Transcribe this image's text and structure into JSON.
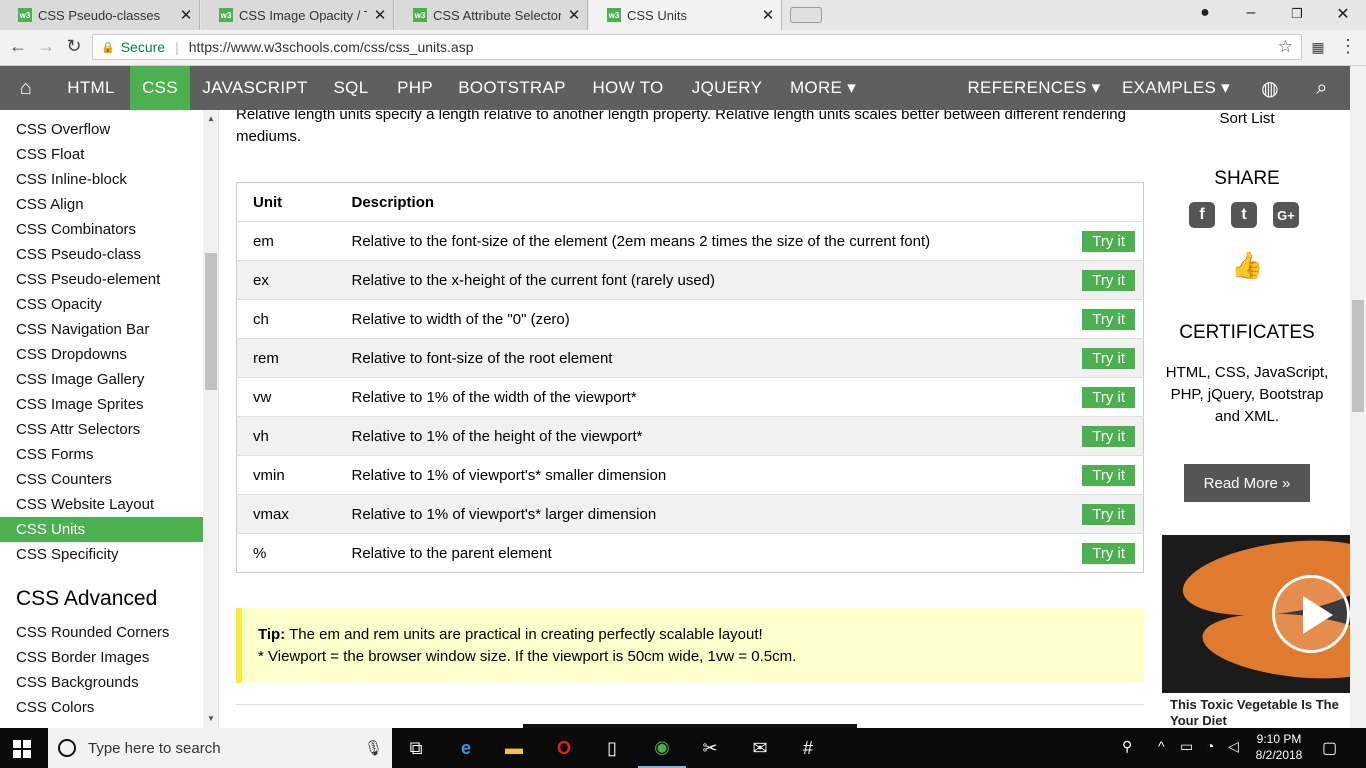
{
  "browser": {
    "tabs": [
      {
        "title": "CSS Pseudo-classes",
        "favicon": "w3"
      },
      {
        "title": "CSS Image Opacity / Tran",
        "favicon": "w3"
      },
      {
        "title": "CSS Attribute Selector",
        "favicon": "w3"
      },
      {
        "title": "CSS Units",
        "favicon": "w3",
        "active": true
      }
    ],
    "secure_label": "Secure",
    "url": "https://www.w3schools.com/css/css_units.asp"
  },
  "topnav": {
    "items": [
      "HTML",
      "CSS",
      "JAVASCRIPT",
      "SQL",
      "PHP",
      "BOOTSTRAP",
      "HOW TO",
      "JQUERY",
      "MORE ▾",
      "REFERENCES ▾",
      "EXAMPLES ▾"
    ],
    "active": "CSS"
  },
  "sidebar": {
    "items": [
      "CSS Overflow",
      "CSS Float",
      "CSS Inline-block",
      "CSS Align",
      "CSS Combinators",
      "CSS Pseudo-class",
      "CSS Pseudo-element",
      "CSS Opacity",
      "CSS Navigation Bar",
      "CSS Dropdowns",
      "CSS Image Gallery",
      "CSS Image Sprites",
      "CSS Attr Selectors",
      "CSS Forms",
      "CSS Counters",
      "CSS Website Layout",
      "CSS Units",
      "CSS Specificity"
    ],
    "active": "CSS Units",
    "section_heading": "CSS Advanced",
    "advanced_items": [
      "CSS Rounded Corners",
      "CSS Border Images",
      "CSS Backgrounds",
      "CSS Colors"
    ]
  },
  "main": {
    "intro": "Relative length units specify a length relative to another length property. Relative length units scales better between different rendering mediums.",
    "table": {
      "headers": [
        "Unit",
        "Description"
      ],
      "rows": [
        {
          "unit": "em",
          "description": "Relative to the font-size of the element (2em means 2 times the size of the current font)"
        },
        {
          "unit": "ex",
          "description": "Relative to the x-height of the current font (rarely used)"
        },
        {
          "unit": "ch",
          "description": "Relative to width of the \"0\" (zero)"
        },
        {
          "unit": "rem",
          "description": "Relative to font-size of the root element"
        },
        {
          "unit": "vw",
          "description": "Relative to 1% of the width of the viewport*"
        },
        {
          "unit": "vh",
          "description": "Relative to 1% of the height of the viewport*"
        },
        {
          "unit": "vmin",
          "description": "Relative to 1% of viewport's* smaller dimension"
        },
        {
          "unit": "vmax",
          "description": "Relative to 1% of viewport's* larger dimension"
        },
        {
          "unit": "%",
          "description": "Relative to the parent element"
        }
      ],
      "try_label": "Try it"
    },
    "tip": {
      "label": "Tip:",
      "text": " The em and rem units are practical in creating perfectly scalable layout!",
      "note": "* Viewport = the browser window size. If the viewport is 50cm wide, 1vw = 0.5cm."
    }
  },
  "right": {
    "sort_list": "Sort List",
    "share": "SHARE",
    "certificates": "CERTIFICATES",
    "cert_text": "HTML, CSS, JavaScript, PHP, jQuery, Bootstrap and XML.",
    "read_more": "Read More »",
    "ad_title": "This Toxic Vegetable Is The Your Diet"
  },
  "taskbar": {
    "search_placeholder": "Type here to search",
    "time": "9:10 PM",
    "date": "8/2/2018"
  },
  "colors": {
    "accent": "#4caf50",
    "nav": "#5f5f5f",
    "tip_bg": "#ffffcc",
    "tip_border": "#ffeb3b"
  }
}
